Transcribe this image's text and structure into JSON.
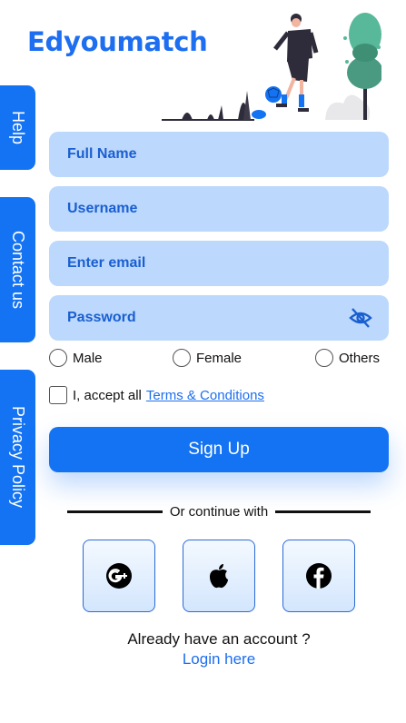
{
  "brand": {
    "name": "Edyoumatch",
    "color": "#1d6ef0"
  },
  "side_tabs": {
    "help": "Help",
    "contact": "Contact us",
    "privacy": "Privacy Policy"
  },
  "form": {
    "full_name_placeholder": "Full Name",
    "username_placeholder": "Username",
    "email_placeholder": "Enter email",
    "password_placeholder": "Password",
    "password_icon": "eye-off-icon"
  },
  "gender": {
    "male": "Male",
    "female": "Female",
    "others": "Others"
  },
  "terms": {
    "prefix": "I, accept all",
    "link": "Terms & Conditions"
  },
  "signup_label": "Sign Up",
  "divider_text": "Or continue with",
  "social": {
    "google": "google-plus-icon",
    "apple": "apple-icon",
    "facebook": "facebook-icon"
  },
  "footer": {
    "prompt": "Already have an account ?",
    "login": "Login here"
  },
  "colors": {
    "primary": "#1473f3",
    "field_bg": "#bcd8fd",
    "field_text": "#1a5fd0"
  }
}
